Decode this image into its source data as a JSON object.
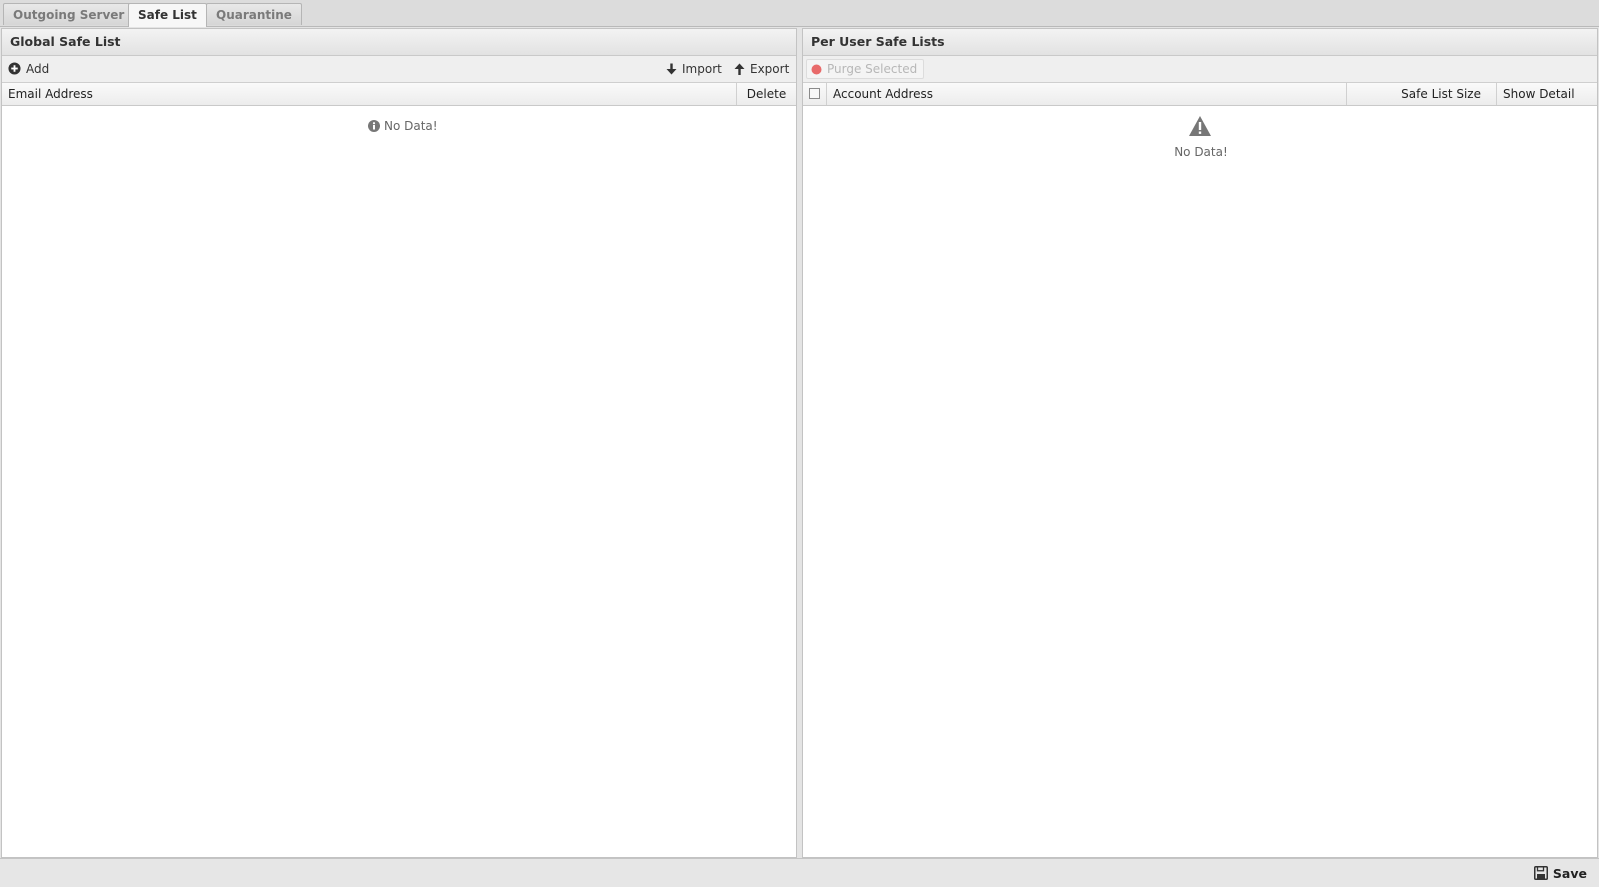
{
  "tabs": [
    {
      "label": "Outgoing Server",
      "active": false
    },
    {
      "label": "Safe List",
      "active": true
    },
    {
      "label": "Quarantine",
      "active": false
    }
  ],
  "global_safe_list": {
    "title": "Global Safe List",
    "toolbar": {
      "add_label": "Add",
      "import_label": "Import",
      "export_label": "Export"
    },
    "columns": {
      "email_address": "Email Address",
      "delete": "Delete"
    },
    "rows": [],
    "empty_message": "No Data!"
  },
  "per_user_safe_lists": {
    "title": "Per User Safe Lists",
    "toolbar": {
      "purge_selected_label": "Purge Selected"
    },
    "columns": {
      "account_address": "Account Address",
      "safe_list_size": "Safe List Size",
      "show_detail": "Show Detail"
    },
    "rows": [],
    "empty_message": "No Data!"
  },
  "footer": {
    "save_label": "Save"
  },
  "icons": {
    "add": "plus-circle-icon",
    "import": "arrow-down-icon",
    "export": "arrow-up-icon",
    "purge": "red-dot-icon",
    "info": "info-icon",
    "warning": "warning-icon",
    "save": "floppy-disk-icon"
  },
  "colors": {
    "purge_dot": "#e05555",
    "icon_gray": "#777777"
  }
}
